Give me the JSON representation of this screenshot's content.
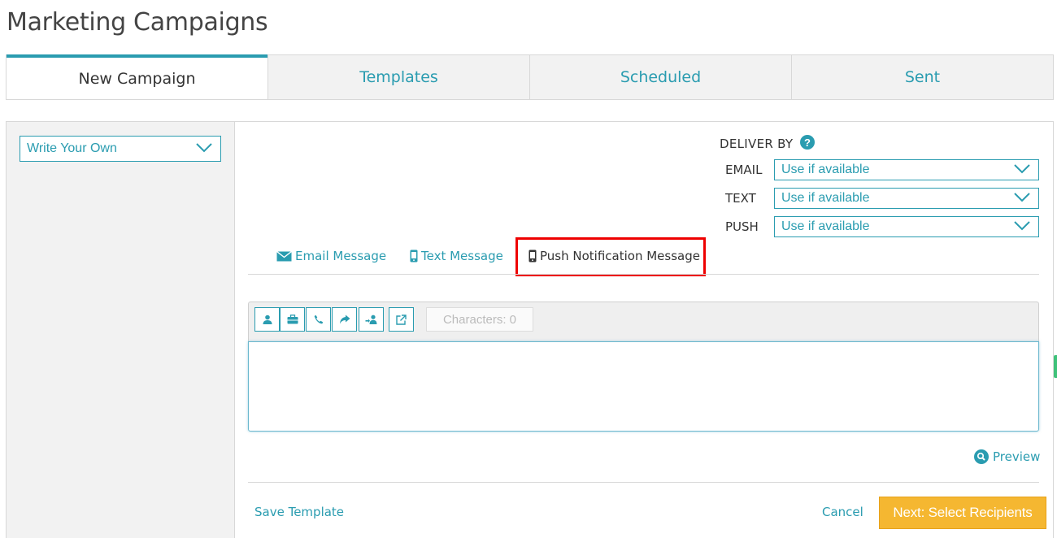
{
  "page": {
    "title": "Marketing Campaigns"
  },
  "tabs": [
    {
      "label": "New Campaign",
      "active": true
    },
    {
      "label": "Templates",
      "active": false
    },
    {
      "label": "Scheduled",
      "active": false
    },
    {
      "label": "Sent",
      "active": false
    }
  ],
  "sidebar": {
    "template_select": "Write Your Own"
  },
  "deliver_by": {
    "label": "DELIVER BY",
    "help_icon": "?",
    "channels": [
      {
        "label": "EMAIL",
        "value": "Use if available"
      },
      {
        "label": "TEXT",
        "value": "Use if available"
      },
      {
        "label": "PUSH",
        "value": "Use if available"
      }
    ]
  },
  "message_tabs": [
    {
      "label": "Email Message",
      "icon": "envelope-icon"
    },
    {
      "label": "Text Message",
      "icon": "mobile-phone-icon"
    },
    {
      "label": "Push Notification Message",
      "icon": "mobile-phone-icon",
      "active": true
    }
  ],
  "editor": {
    "toolbar_icons": [
      "person-icon",
      "briefcase-icon",
      "phone-icon",
      "share-arrow-icon",
      "transfer-user-icon",
      "external-link-icon"
    ],
    "characters_label": "Characters: 0",
    "body": ""
  },
  "preview_label": "Preview",
  "footer": {
    "save_template": "Save Template",
    "cancel": "Cancel",
    "next": "Next: Select Recipients"
  },
  "colors": {
    "accent": "#2a9cb0",
    "primary_button": "#f5b731",
    "highlight": "#e00000"
  }
}
